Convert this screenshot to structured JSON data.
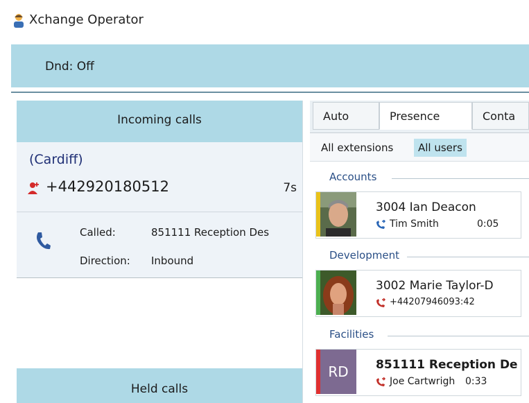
{
  "app": {
    "title": "Xchange Operator"
  },
  "toolbar": {
    "dnd_label": "Dnd: Off"
  },
  "incoming": {
    "header": "Incoming calls",
    "call": {
      "location": "(Cardiff)",
      "number": "+442920180512",
      "time": "7s",
      "called_label": "Called:",
      "called_value": "851111 Reception Des",
      "direction_label": "Direction:",
      "direction_value": "Inbound"
    }
  },
  "held": {
    "header": "Held calls"
  },
  "tabs": [
    "Auto",
    "Presence",
    "Conta"
  ],
  "subtabs": [
    "All extensions",
    "All users"
  ],
  "groups": [
    {
      "name": "Accounts"
    },
    {
      "name": "Development"
    },
    {
      "name": "Facilities"
    }
  ],
  "extensions": [
    {
      "name": "3004 Ian Deacon",
      "party": "Tim Smith",
      "duration": "0:05",
      "status_color": "#e9c21a"
    },
    {
      "name": "3002 Marie Taylor-D",
      "party": "+44207946093:42",
      "duration": "",
      "status_color": "#4caf50"
    },
    {
      "name": "851111 Reception De",
      "party": "Joe Cartwrigh",
      "duration": "0:33",
      "initials": "RD",
      "status_color": "#e03030"
    }
  ],
  "colors": {
    "accent": "#aed9e6",
    "group_text": "#2a4f86",
    "location_text": "#1f2f75"
  }
}
